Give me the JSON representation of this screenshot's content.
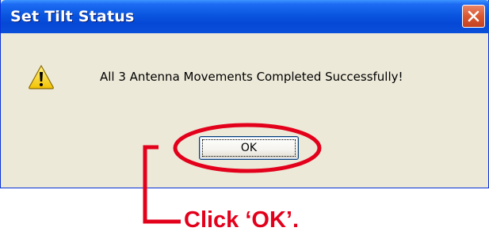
{
  "dialog": {
    "title": "Set Tilt Status",
    "message": "All 3 Antenna Movements Completed Successfully!",
    "ok_label": "OK",
    "icon": "warning-icon",
    "close_icon": "close-icon"
  },
  "annotation": {
    "callout_text": "Click ‘OK’.",
    "color": "#e3001b"
  },
  "colors": {
    "titlebar": "#0a56e0",
    "dialog_background": "#ece9d8",
    "close_button": "#d9582f"
  }
}
